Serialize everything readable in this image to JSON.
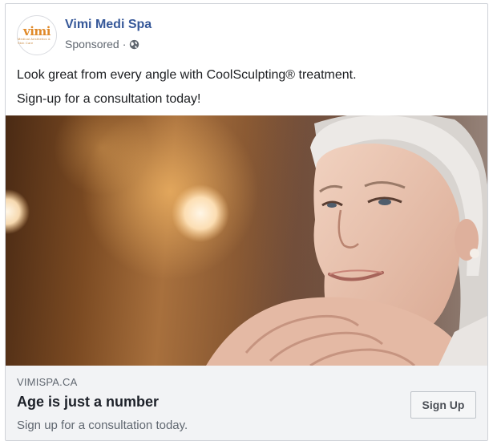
{
  "post": {
    "page_name": "Vimi Medi Spa",
    "avatar": {
      "logo_text": "vimi",
      "logo_subtext": "Medical Aesthetics & Skin Care"
    },
    "sponsored_label": "Sponsored",
    "separator": "·",
    "audience_icon": "globe-icon",
    "caption_lines": [
      "Look great from every angle with CoolSculpting® treatment.",
      "Sign-up for a consultation today!"
    ]
  },
  "link_card": {
    "domain": "VIMISPA.CA",
    "headline": "Age is just a number",
    "description": "Sign up for a consultation today.",
    "cta_label": "Sign Up"
  },
  "colors": {
    "page_name": "#365899",
    "secondary_text": "#606770",
    "card_background": "#f2f3f5",
    "brand_orange": "#e08a2a"
  }
}
